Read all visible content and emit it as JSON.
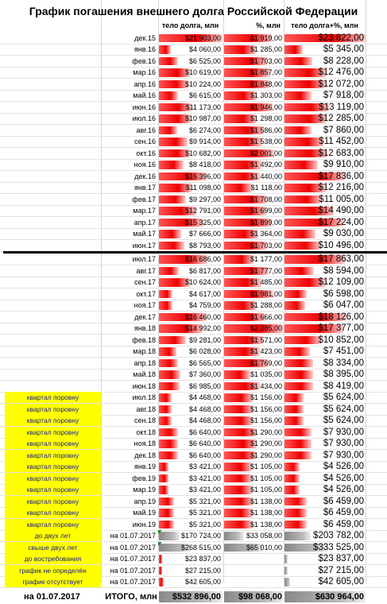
{
  "title": "График погашения внешнего долга Российской Федерации",
  "headers": {
    "body": "тело долга, млн",
    "pct": "%, млн",
    "total": "тело долга+%, млн"
  },
  "colors": {
    "highlight": "#ffff00",
    "bar_red": "#ee0000",
    "bar_gray": "#999999"
  },
  "rows": [
    {
      "label": "",
      "date": "дек.15",
      "body": "$21 903,00",
      "pct": "$1 919,00",
      "total": "$23 822,00"
    },
    {
      "label": "",
      "date": "янв.16",
      "body": "$4 060,00",
      "pct": "$1 285,00",
      "total": "$5 345,00"
    },
    {
      "label": "",
      "date": "фев.16",
      "body": "$6 525,00",
      "pct": "$1 703,00",
      "total": "$8 228,00"
    },
    {
      "label": "",
      "date": "мар.16",
      "body": "$10 619,00",
      "pct": "$1 857,00",
      "total": "$12 476,00"
    },
    {
      "label": "",
      "date": "апр.16",
      "body": "$10 224,00",
      "pct": "$1 848,00",
      "total": "$12 072,00"
    },
    {
      "label": "",
      "date": "май.16",
      "body": "$6 615,00",
      "pct": "$1 303,00",
      "total": "$7 918,00"
    },
    {
      "label": "",
      "date": "июн.16",
      "body": "$11 173,00",
      "pct": "$1 946,00",
      "total": "$13 119,00"
    },
    {
      "label": "",
      "date": "июл.16",
      "body": "$10 987,00",
      "pct": "$1 298,00",
      "total": "$12 285,00"
    },
    {
      "label": "",
      "date": "авг.16",
      "body": "$6 274,00",
      "pct": "$1 586,00",
      "total": "$7 860,00"
    },
    {
      "label": "",
      "date": "сен.16",
      "body": "$9 914,00",
      "pct": "$1 538,00",
      "total": "$11 452,00"
    },
    {
      "label": "",
      "date": "окт.16",
      "body": "$10 682,00",
      "pct": "$2 001,00",
      "total": "$12 683,00"
    },
    {
      "label": "",
      "date": "ноя.16",
      "body": "$8 418,00",
      "pct": "$1 492,00",
      "total": "$9 910,00"
    },
    {
      "label": "",
      "date": "дек.16",
      "body": "$16 396,00",
      "pct": "$1 440,00",
      "total": "$17 836,00"
    },
    {
      "label": "",
      "date": "янв.17",
      "body": "$11 098,00",
      "pct": "$1 118,00",
      "total": "$12 216,00"
    },
    {
      "label": "",
      "date": "фев.17",
      "body": "$9 297,00",
      "pct": "$1 708,00",
      "total": "$11 005,00"
    },
    {
      "label": "",
      "date": "мар.17",
      "body": "$12 791,00",
      "pct": "$1 699,00",
      "total": "$14 490,00"
    },
    {
      "label": "",
      "date": "апр.17",
      "body": "$15 325,00",
      "pct": "$1 899,00",
      "total": "$17 224,00"
    },
    {
      "label": "",
      "date": "май.17",
      "body": "$7 666,00",
      "pct": "$1 364,00",
      "total": "$9 030,00"
    },
    {
      "label": "",
      "date": "июн.17",
      "body": "$8 793,00",
      "pct": "$1 703,00",
      "total": "$10 496,00"
    },
    {
      "label": "",
      "date": "июл.17",
      "body": "$16 686,00",
      "pct": "$1 177,00",
      "total": "$17 863,00"
    },
    {
      "label": "",
      "date": "авг.17",
      "body": "$6 817,00",
      "pct": "$1 777,00",
      "total": "$8 594,00"
    },
    {
      "label": "",
      "date": "сен.17",
      "body": "$10 624,00",
      "pct": "$1 485,00",
      "total": "$12 109,00"
    },
    {
      "label": "",
      "date": "окт.17",
      "body": "$4 617,00",
      "pct": "$1 981,00",
      "total": "$6 598,00"
    },
    {
      "label": "",
      "date": "ноя.17",
      "body": "$4 759,00",
      "pct": "$1 288,00",
      "total": "$6 047,00"
    },
    {
      "label": "",
      "date": "дек.17",
      "body": "$16 460,00",
      "pct": "$1 666,00",
      "total": "$18 126,00"
    },
    {
      "label": "",
      "date": "янв.18",
      "body": "$14 992,00",
      "pct": "$2 385,00",
      "total": "$17 377,00"
    },
    {
      "label": "",
      "date": "фев.18",
      "body": "$9 281,00",
      "pct": "$1 571,00",
      "total": "$10 852,00"
    },
    {
      "label": "",
      "date": "мар.18",
      "body": "$6 028,00",
      "pct": "$1 423,00",
      "total": "$7 451,00"
    },
    {
      "label": "",
      "date": "апр.18",
      "body": "$6 565,00",
      "pct": "$1 769,00",
      "total": "$8 334,00"
    },
    {
      "label": "",
      "date": "май.18",
      "body": "$7 360,00",
      "pct": "$1 035,00",
      "total": "$8 395,00"
    },
    {
      "label": "",
      "date": "июн.18",
      "body": "$6 985,00",
      "pct": "$1 434,00",
      "total": "$8 419,00"
    },
    {
      "label": "квартал поровну",
      "date": "июл.18",
      "body": "$4 468,00",
      "pct": "$1 156,00",
      "total": "$5 624,00"
    },
    {
      "label": "квартал поровну",
      "date": "авг.18",
      "body": "$4 468,00",
      "pct": "$1 156,00",
      "total": "$5 624,00"
    },
    {
      "label": "квартал поровну",
      "date": "сен.18",
      "body": "$4 468,00",
      "pct": "$1 156,00",
      "total": "$5 624,00"
    },
    {
      "label": "квартал поровну",
      "date": "окт.18",
      "body": "$6 640,00",
      "pct": "$1 290,00",
      "total": "$7 930,00"
    },
    {
      "label": "квартал поровну",
      "date": "ноя.18",
      "body": "$6 640,00",
      "pct": "$1 290,00",
      "total": "$7 930,00"
    },
    {
      "label": "квартал поровну",
      "date": "дек.18",
      "body": "$6 640,00",
      "pct": "$1 290,00",
      "total": "$7 930,00"
    },
    {
      "label": "квартал поровну",
      "date": "янв.19",
      "body": "$3 421,00",
      "pct": "$1 105,00",
      "total": "$4 526,00"
    },
    {
      "label": "квартал поровну",
      "date": "фев.19",
      "body": "$3 421,00",
      "pct": "$1 105,00",
      "total": "$4 526,00"
    },
    {
      "label": "квартал поровну",
      "date": "мар.19",
      "body": "$3 421,00",
      "pct": "$1 105,00",
      "total": "$4 526,00"
    },
    {
      "label": "квартал поровну",
      "date": "апр.19",
      "body": "$5 321,00",
      "pct": "$1 138,00",
      "total": "$6 459,00"
    },
    {
      "label": "квартал поровну",
      "date": "май.19",
      "body": "$5 321,00",
      "pct": "$1 138,00",
      "total": "$6 459,00"
    },
    {
      "label": "квартал поровну",
      "date": "июн.19",
      "body": "$5 321,00",
      "pct": "$1 138,00",
      "total": "$6 459,00"
    },
    {
      "label": "до двух лет",
      "date": "на 01.07.2017",
      "body": "$170 724,00",
      "pct": "$33 058,00",
      "total": "$203 782,00"
    },
    {
      "label": "свыше двух лет",
      "date": "на 01.07.2017",
      "body": "$268 515,00",
      "pct": "$65 010,00",
      "total": "$333 525,00"
    },
    {
      "label": "до востребования",
      "date": "на 01.07.2017",
      "body": "$23 837,00",
      "pct": "",
      "total": "$23 837,00"
    },
    {
      "label": "график не определён",
      "date": "на 01.07.2017",
      "body": "$27 215,00",
      "pct": "",
      "total": "$27 215,00"
    },
    {
      "label": "график отсутствует",
      "date": "на 01.07.2017",
      "body": "$42 605,00",
      "pct": "",
      "total": "$42 605,00"
    }
  ],
  "total": {
    "date": "на 01.07.2017",
    "label": "ИТОГО, млн",
    "body": "$532 896,00",
    "pct": "$98 068,00",
    "total": "$630 964,00"
  }
}
